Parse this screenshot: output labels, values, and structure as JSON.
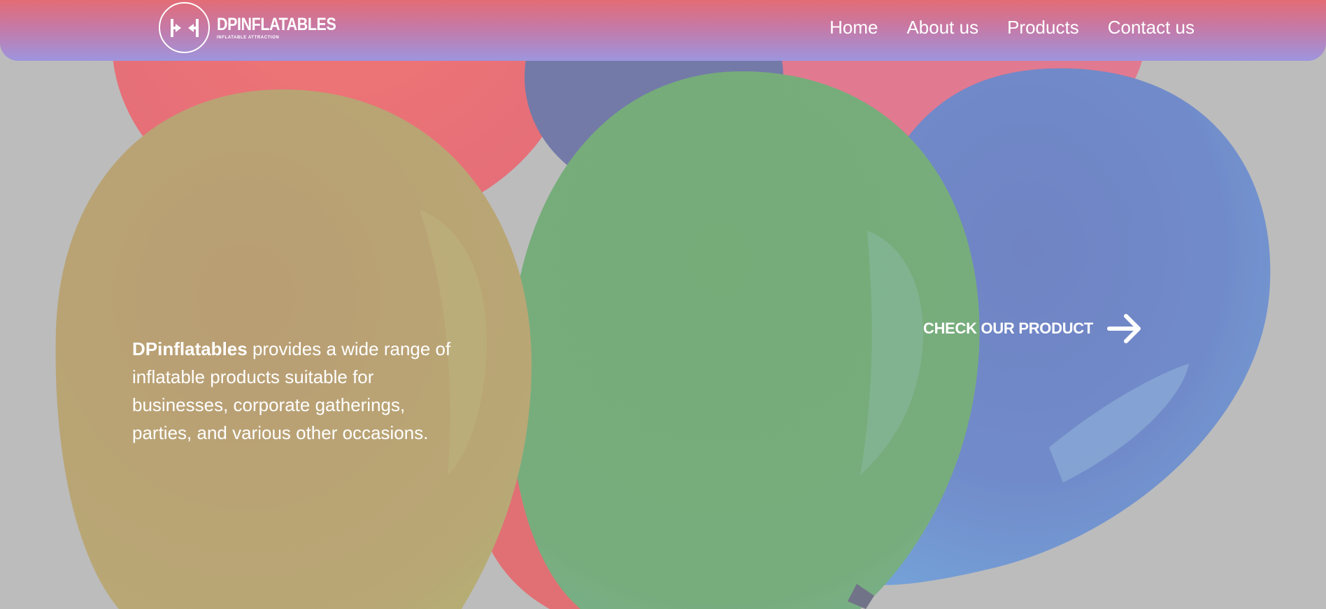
{
  "brand": {
    "name": "DPINFLATABLES",
    "tagline": "Inflatable attraction",
    "logo_icon": "bracket-arrows-icon"
  },
  "nav": {
    "items": [
      {
        "label": "Home"
      },
      {
        "label": "About us"
      },
      {
        "label": "Products"
      },
      {
        "label": "Contact us"
      }
    ]
  },
  "hero": {
    "intro_brand": "DPinflatables",
    "intro_text": " provides a wide range of inflatable products suitable for businesses, corporate gatherings, parties, and various other occasions.",
    "cta_label": "CHECK OUR PRODUCT",
    "cta_icon": "arrow-right-icon"
  },
  "colors": {
    "header_gradient_top": "#e36c75",
    "header_gradient_bottom": "#9d95de",
    "balloon_yellow": "#b99c6d",
    "balloon_green": "#70ab72",
    "balloon_blue": "#6b86c9",
    "balloon_red": "#f06b6e",
    "background": "#bcbcbc"
  }
}
